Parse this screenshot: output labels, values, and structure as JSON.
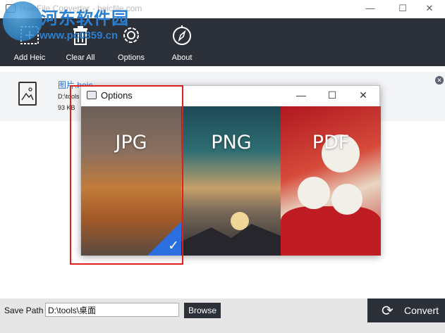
{
  "window": {
    "title": "HeicFile Converter - heicfile.com",
    "min_glyph": "—",
    "max_glyph": "☐",
    "close_glyph": "✕"
  },
  "watermark": {
    "text": "河东软件园",
    "url": "www.pc0359.cn"
  },
  "toolbar": {
    "items": [
      {
        "label": "Add Heic",
        "icon": "add-file-icon"
      },
      {
        "label": "Clear All",
        "icon": "trash-icon"
      },
      {
        "label": "Options",
        "icon": "gear-icon"
      },
      {
        "label": "About",
        "icon": "compass-icon"
      }
    ]
  },
  "file": {
    "name": "图片.heic",
    "path": "D:\\tools",
    "size": "93 KB",
    "remove_glyph": "✕"
  },
  "options_dialog": {
    "title": "Options",
    "min_glyph": "—",
    "max_glyph": "☐",
    "close_glyph": "✕",
    "formats": [
      {
        "label": "JPG",
        "selected": true
      },
      {
        "label": "PNG",
        "selected": false
      },
      {
        "label": "PDF",
        "selected": false
      }
    ],
    "check_glyph": "✓"
  },
  "bottom": {
    "save_label": "Save Path",
    "save_path": "D:\\tools\\桌面",
    "browse_label": "Browse",
    "convert_label": "Convert",
    "convert_glyph": "⟳"
  },
  "colors": {
    "toolbar_bg": "#2c3038",
    "accent_blue": "#2a6ee0",
    "highlight_red": "#e0201a"
  }
}
